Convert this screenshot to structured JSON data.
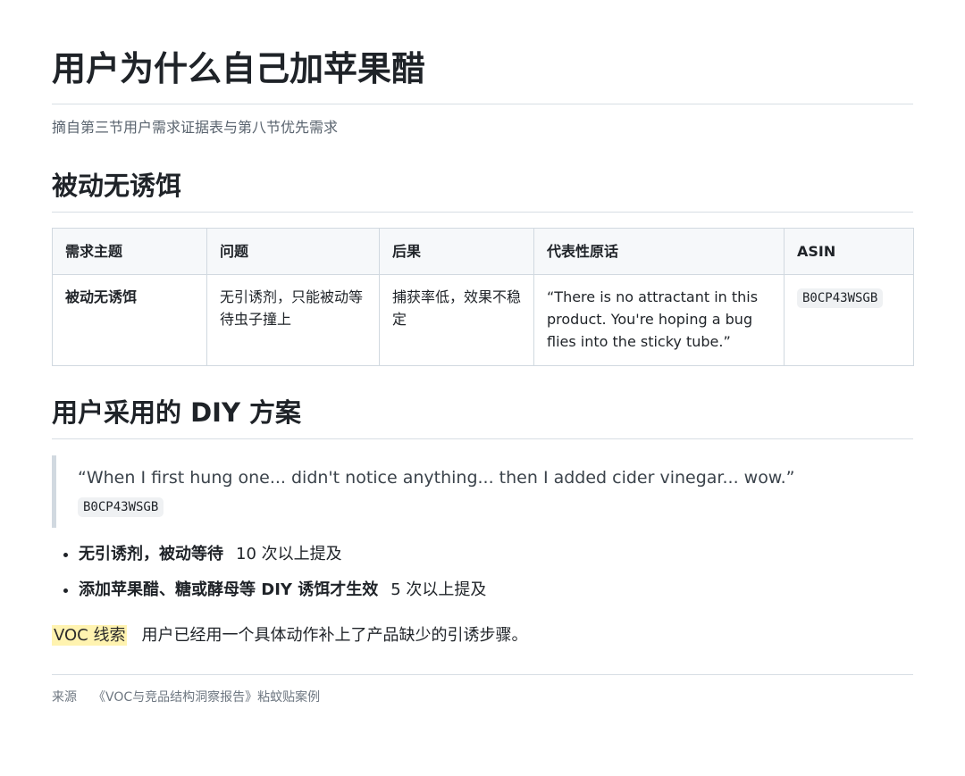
{
  "title": "用户为什么自己加苹果醋",
  "subtitle": "摘自第三节用户需求证据表与第八节优先需求",
  "section1": {
    "heading": "被动无诱饵",
    "table": {
      "headers": [
        "需求主题",
        "问题",
        "后果",
        "代表性原话",
        "ASIN"
      ],
      "rows": [
        {
          "topic": "被动无诱饵",
          "problem": "无引诱剂，只能被动等待虫子撞上",
          "consequence": "捕获率低，效果不稳定",
          "quote": "“There is no attractant in this product. You're hoping a bug flies into the sticky tube.”",
          "asin": "B0CP43WSGB"
        }
      ]
    }
  },
  "section2": {
    "heading": "用户采用的 DIY 方案",
    "quote": "“When I first hung one... didn't notice anything... then I added cider vinegar... wow.”",
    "quote_asin": "B0CP43WSGB",
    "bullets": [
      {
        "bold": "无引诱剂，被动等待",
        "text": "10 次以上提及"
      },
      {
        "bold": "添加苹果醋、糖或酵母等 DIY 诱饵才生效",
        "text": "5 次以上提及"
      }
    ],
    "voc_tag": "VOC 线索",
    "voc_text": "用户已经用一个具体动作补上了产品缺少的引诱步骤。"
  },
  "footer": {
    "label": "来源",
    "source": "《VOC与竞品结构洞察报告》粘蚊贴案例"
  },
  "colors": {
    "highlight": "#fff3b0",
    "border": "#d1d9e0",
    "header_bg": "#f6f8fa"
  }
}
